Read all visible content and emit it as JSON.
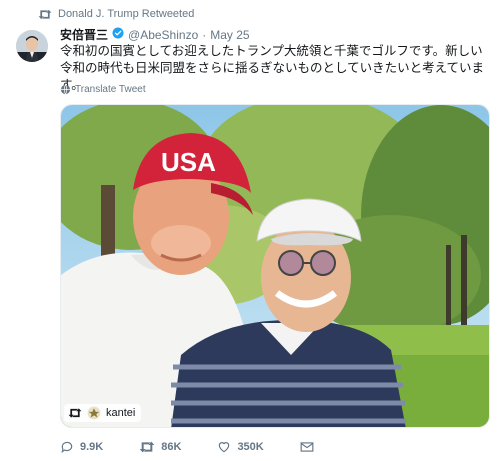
{
  "retweet": {
    "text": "Donald J. Trump Retweeted"
  },
  "author": {
    "name": "安倍晋三",
    "verified": true,
    "handle": "@AbeShinzo",
    "separator": "·",
    "date": "May 25"
  },
  "tweet": {
    "text": "令和初の国賓としてお迎えしたトランプ大統領と千葉でゴルフです。新しい令和の時代も日米同盟をさらに揺るぎないものとしていきたいと考えています。"
  },
  "translate": {
    "label": "Translate Tweet"
  },
  "media": {
    "badge": "kantei",
    "cap_text": "USA"
  },
  "actions": {
    "replies": "9.9K",
    "retweets": "86K",
    "likes": "350K"
  },
  "colors": {
    "verified": "#1da1f2",
    "meta": "#657786",
    "cap": "#d3233a"
  }
}
